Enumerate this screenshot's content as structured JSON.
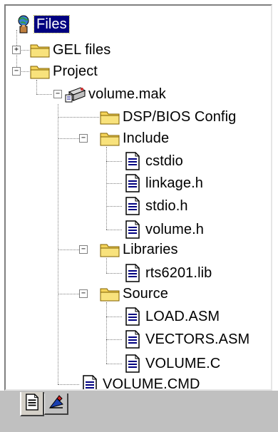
{
  "tree": {
    "root_label": "Files",
    "gel_files": "GEL files",
    "project": "Project",
    "project_file": "volume.mak",
    "dsp_bios_config": "DSP/BIOS Config",
    "include": "Include",
    "include_files": [
      "cstdio",
      "linkage.h",
      "stdio.h",
      "volume.h"
    ],
    "libraries": "Libraries",
    "library_files": [
      "rts6201.lib"
    ],
    "source": "Source",
    "source_files": [
      "LOAD.ASM",
      "VECTORS.ASM",
      "VOLUME.C"
    ],
    "cmd_file": "VOLUME.CMD"
  },
  "expanders": {
    "collapsed": "+",
    "expanded": "−"
  },
  "tabs": {
    "files_icon": "file-view-icon",
    "project_icon": "bios-view-icon"
  },
  "colors": {
    "selection": "#000080",
    "folder": "#f4d35a",
    "tree_lines": "#808080",
    "tab_bar": "#c0c0c0"
  }
}
